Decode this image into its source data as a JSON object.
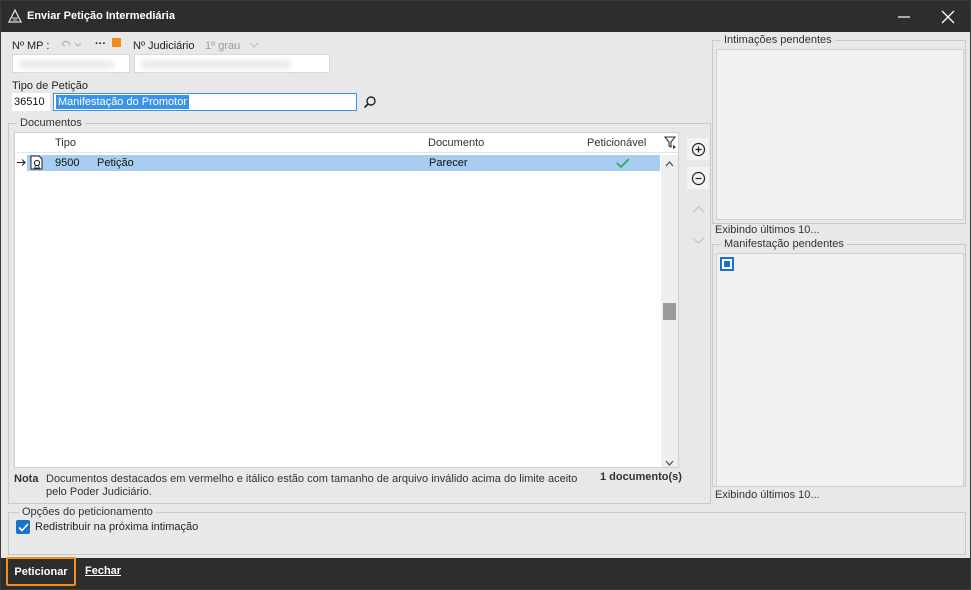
{
  "window": {
    "title": "Enviar Petição Intermediária"
  },
  "header": {
    "mp_label": "Nº MP :",
    "judiciario_label": "Nº Judiciário",
    "grau_label": "1º grau",
    "more_label": "···",
    "flag_color": "#f28c1c"
  },
  "tipo": {
    "label": "Tipo de Petição",
    "code": "36510",
    "description": "Manifestação do Promotor"
  },
  "documentos": {
    "group_title": "Documentos",
    "columns": [
      "Tipo",
      "Documento",
      "Peticionável"
    ],
    "rows": [
      {
        "code": "9500",
        "tipo": "Petição",
        "documento": "Parecer",
        "peticionavel": true
      }
    ],
    "note_label": "Nota",
    "note_text": "Documentos destacados em vermelho e itálico estão com tamanho de arquivo inválido acima do limite aceito pelo Poder Judiciário.",
    "count": "1 documento(s)"
  },
  "intimacoes": {
    "title": "Intimações pendentes",
    "footer": "Exibindo últimos 10..."
  },
  "manifestacao": {
    "title": "Manifestação pendentes",
    "footer": "Exibindo últimos 10..."
  },
  "opcoes": {
    "title": "Opções do peticionamento",
    "redistribuir_label": "Redistribuir na próxima intimação",
    "redistribuir_checked": true
  },
  "footer": {
    "peticionar": "Peticionar",
    "fechar": "Fechar"
  },
  "colors": {
    "selection_row": "#a7cdf0",
    "selection_text": "#3a93e6",
    "accent": "#f28c1c",
    "check": "#2fa84f"
  }
}
